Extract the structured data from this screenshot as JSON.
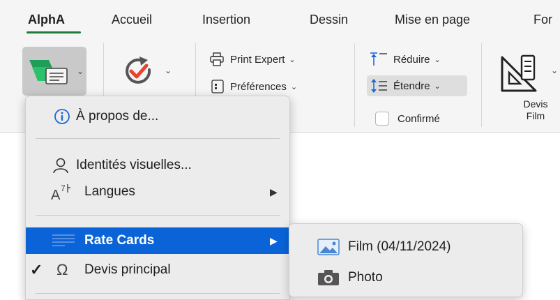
{
  "tabs": [
    {
      "label": "AlphA",
      "active": true
    },
    {
      "label": "Accueil",
      "active": false
    },
    {
      "label": "Insertion",
      "active": false
    },
    {
      "label": "Dessin",
      "active": false
    },
    {
      "label": "Mise en page",
      "active": false
    },
    {
      "label": "For",
      "active": false
    }
  ],
  "ribbon": {
    "print_expert": "Print Expert",
    "preferences": "Préférences",
    "reduire": "Réduire",
    "etendre": "Étendre",
    "confirme": "Confirmé",
    "devis_film": "Devis Film"
  },
  "menu": {
    "items": [
      {
        "label": "À propos de...",
        "icon": "info-icon"
      },
      {
        "label": "Identités visuelles...",
        "icon": "person-icon"
      },
      {
        "label": "Langues",
        "icon": "translate-icon",
        "has_submenu": true
      },
      {
        "label": "Rate Cards",
        "icon": "rate-card-icon",
        "has_submenu": true,
        "highlighted": true
      },
      {
        "label": "Devis principal",
        "icon": "omega-icon",
        "checked": true
      }
    ]
  },
  "submenu": {
    "items": [
      {
        "label": "Film (04/11/2024)",
        "icon": "image-icon"
      },
      {
        "label": "Photo",
        "icon": "camera-icon"
      }
    ]
  },
  "colors": {
    "accent": "#1f7a3d",
    "highlight": "#0a64d8",
    "menu_bg": "#ececec",
    "ribbon_bg": "#f5f5f5"
  }
}
